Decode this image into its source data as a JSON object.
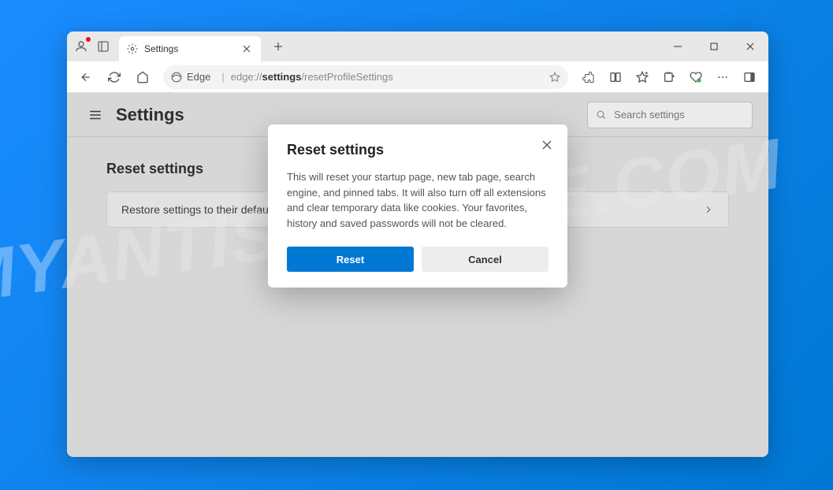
{
  "watermark": "MYANTISPYWARE.COM",
  "tab": {
    "title": "Settings"
  },
  "addressbar": {
    "prefix": "Edge",
    "url_gray1": "edge://",
    "url_bold": "settings",
    "url_gray2": "/resetProfileSettings"
  },
  "settings": {
    "page_title": "Settings",
    "search_placeholder": "Search settings",
    "section_title": "Reset settings",
    "row_label": "Restore settings to their default values"
  },
  "dialog": {
    "title": "Reset settings",
    "body": "This will reset your startup page, new tab page, search engine, and pinned tabs. It will also turn off all extensions and clear temporary data like cookies. Your favorites, history and saved passwords will not be cleared.",
    "reset_label": "Reset",
    "cancel_label": "Cancel"
  }
}
